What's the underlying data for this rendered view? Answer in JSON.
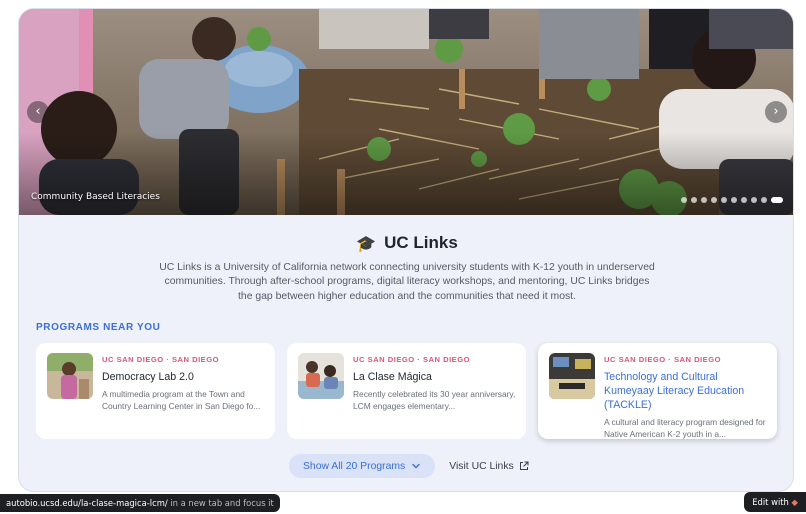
{
  "hero": {
    "caption": "Community Based Literacies",
    "prev_icon": "chevron-left-icon",
    "next_icon": "chevron-right-icon",
    "slide_count": 10,
    "active_slide": 10
  },
  "header": {
    "icon": "graduation-cap-icon",
    "icon_glyph": "🎓",
    "title": "UC Links",
    "description": "UC Links is a University of California network connecting university students with K-12 youth in underserved communities. Through after-school programs, digital literacy workshops, and mentoring, UC Links bridges the gap between higher education and the communities that need it most."
  },
  "programs_section": {
    "label": "PROGRAMS NEAR YOU",
    "items": [
      {
        "meta": "UC SAN DIEGO · SAN DIEGO",
        "name": "Democracy Lab 2.0",
        "description": "A multimedia program at the Town and Country Learning Center in San Diego fo..."
      },
      {
        "meta": "UC SAN DIEGO · SAN DIEGO",
        "name": "La Clase Mágica",
        "description": "Recently celebrated its 30 year anniversary, LCM engages elementary..."
      },
      {
        "meta": "UC SAN DIEGO · SAN DIEGO",
        "name": "Technology and Cultural Kumeyaay Literacy Education (TACKLE)",
        "description": "A cultural and literacy program designed for Native American K-2 youth in a..."
      }
    ]
  },
  "actions": {
    "show_all_label": "Show All 20 Programs",
    "show_all_icon": "chevron-down-icon",
    "visit_label": "Visit UC Links",
    "visit_icon": "external-link-icon"
  },
  "status_bar": {
    "url": "autobio.ucsd.edu/la-clase-magica-lcm/",
    "hint": " in a new tab and focus it",
    "edit_label": "Edit with"
  },
  "colors": {
    "accent": "#3b6fd8",
    "meta": "#d9577a",
    "card_bg": "#eef1fa"
  }
}
